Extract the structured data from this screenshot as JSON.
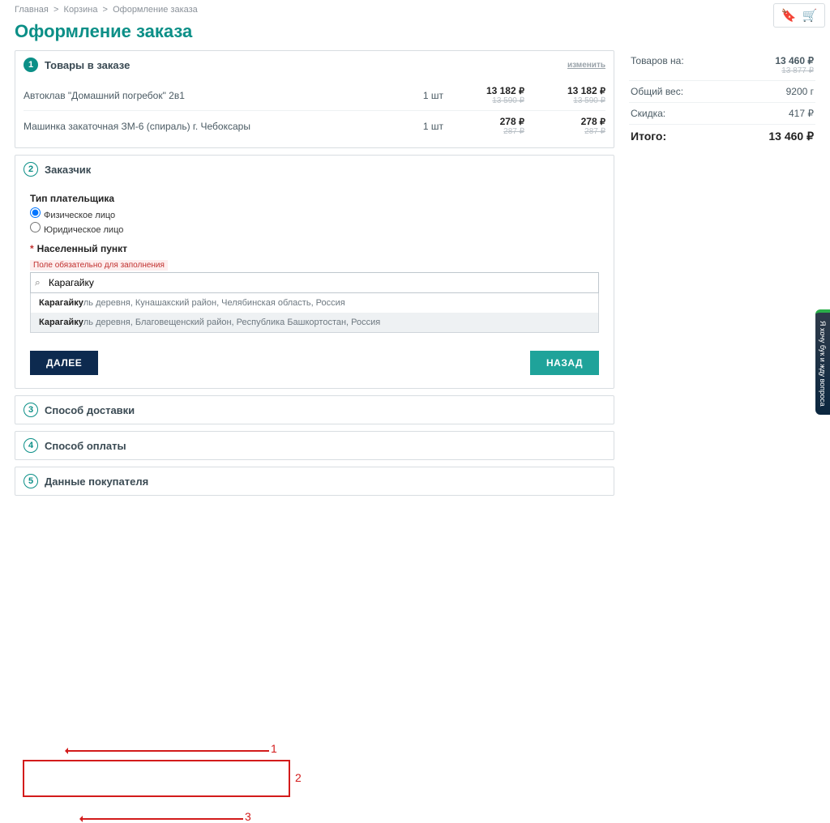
{
  "breadcrumb": {
    "home": "Главная",
    "cart": "Корзина",
    "checkout": "Оформление заказа"
  },
  "title": "Оформление заказа",
  "step1": {
    "num": "1",
    "label": "Товары в заказе",
    "edit": "изменить",
    "items": [
      {
        "name": "Автоклав \"Домашний погребок\" 2в1",
        "qty": "1 шт",
        "price": "13 182",
        "price_old": "13 590 ₽",
        "total": "13 182",
        "total_old": "13 590 ₽"
      },
      {
        "name": "Машинка закаточная ЗМ-6 (спираль) г. Чебоксары",
        "qty": "1 шт",
        "price": "278",
        "price_old": "287 ₽",
        "total": "278",
        "total_old": "287 ₽"
      }
    ]
  },
  "step2": {
    "num": "2",
    "label": "Заказчик",
    "payerTypeLabel": "Тип плательщика",
    "radio1": "Физическое лицо",
    "radio2": "Юридическое лицо",
    "cityLabel": "Населенный пункт",
    "errorText": "Поле обязательно для заполнения",
    "searchValue": "Карагайку",
    "suggest": [
      {
        "match": "Карагайку",
        "rest": "ль деревня, Кунашакский район, Челябинская область, Россия"
      },
      {
        "match": "Карагайку",
        "rest": "ль деревня, Благовещенский район, Республика Башкортостан, Россия"
      }
    ],
    "nextBtn": "ДАЛЕЕ",
    "backBtn": "НАЗАД"
  },
  "step3": {
    "num": "3",
    "label": "Способ доставки"
  },
  "step4": {
    "num": "4",
    "label": "Способ оплаты"
  },
  "step5": {
    "num": "5",
    "label": "Данные покупателя"
  },
  "summary": {
    "goodsLabel": "Товаров на:",
    "goodsVal": "13 460 ₽",
    "goodsOld": "13 877 ₽",
    "weightLabel": "Общий вес:",
    "weightVal": "9200 г",
    "discountLabel": "Скидка:",
    "discountVal": "417 ₽",
    "totalLabel": "Итого:",
    "totalVal": "13 460 ₽"
  },
  "rub": "₽",
  "feedback": "Я хочу бук и жду вопроса",
  "anno": {
    "n1": "1",
    "n2": "2",
    "n3": "3"
  }
}
